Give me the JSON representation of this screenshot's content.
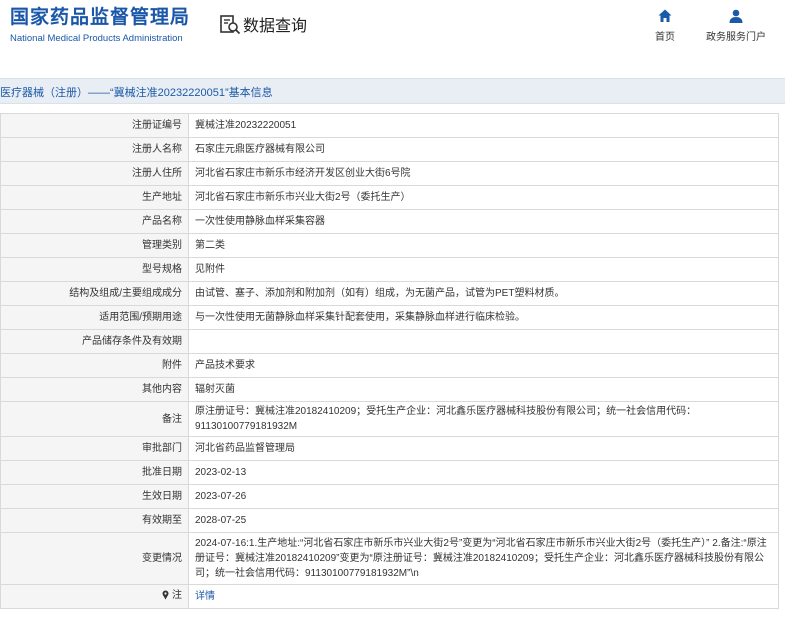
{
  "header": {
    "logo_cn": "国家药品监督管理局",
    "logo_en": "National Medical Products Administration",
    "query_label": "数据查询",
    "nav": [
      {
        "label": "首页",
        "icon": "home-icon"
      },
      {
        "label": "政务服务门户",
        "icon": "user-icon"
      }
    ]
  },
  "titlebar": "医疗器械（注册）——“冀械注准20232220051”基本信息",
  "rows": [
    {
      "key": "注册证编号",
      "value": "冀械注准20232220051"
    },
    {
      "key": "注册人名称",
      "value": "石家庄元鼎医疗器械有限公司"
    },
    {
      "key": "注册人住所",
      "value": "河北省石家庄市新乐市经济开发区创业大街6号院"
    },
    {
      "key": "生产地址",
      "value": "河北省石家庄市新乐市兴业大街2号（委托生产）"
    },
    {
      "key": "产品名称",
      "value": "一次性使用静脉血样采集容器"
    },
    {
      "key": "管理类别",
      "value": "第二类"
    },
    {
      "key": "型号规格",
      "value": "见附件"
    },
    {
      "key": "结构及组成/主要组成成分",
      "value": "由试管、塞子、添加剂和附加剂（如有）组成，为无菌产品，试管为PET塑料材质。"
    },
    {
      "key": "适用范围/预期用途",
      "value": "与一次性使用无菌静脉血样采集针配套使用，采集静脉血样进行临床检验。"
    },
    {
      "key": "产品储存条件及有效期",
      "value": ""
    },
    {
      "key": "附件",
      "value": "产品技术要求"
    },
    {
      "key": "其他内容",
      "value": "辐射灭菌"
    },
    {
      "key": "备注",
      "value": "原注册证号：冀械注准20182410209；受托生产企业：河北鑫乐医疗器械科技股份有限公司；统一社会信用代码：91130100779181932M"
    },
    {
      "key": "审批部门",
      "value": "河北省药品监督管理局"
    },
    {
      "key": "批准日期",
      "value": "2023-02-13"
    },
    {
      "key": "生效日期",
      "value": "2023-07-26"
    },
    {
      "key": "有效期至",
      "value": "2028-07-25"
    },
    {
      "key": "变更情况",
      "value": "2024-07-16:1.生产地址:“河北省石家庄市新乐市兴业大街2号”变更为“河北省石家庄市新乐市兴业大街2号（委托生产）” 2.备注:“原注册证号：冀械注准20182410209”变更为“原注册证号：冀械注准20182410209；受托生产企业：河北鑫乐医疗器械科技股份有限公司；统一社会信用代码：91130100779181932M”\\n"
    },
    {
      "key": "注",
      "value": "详情",
      "icon": "pin-icon"
    }
  ]
}
